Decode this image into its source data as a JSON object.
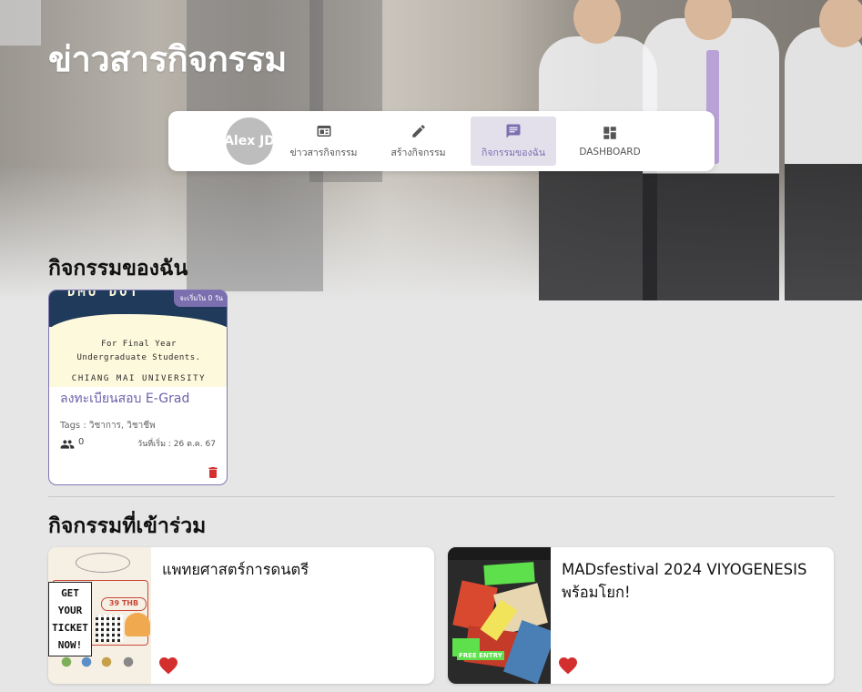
{
  "header": {
    "page_title": "ข่าวสารกิจกรรม"
  },
  "nav": {
    "avatar_text": "Alex JD",
    "items": [
      {
        "label": "ข่าวสารกิจกรรม",
        "icon": "newspaper-icon",
        "active": false
      },
      {
        "label": "สร้างกิจกรรม",
        "icon": "pencil-icon",
        "active": false
      },
      {
        "label": "กิจกรรมของฉัน",
        "icon": "chat-icon",
        "active": true
      },
      {
        "label": "DASHBOARD",
        "icon": "dashboard-icon",
        "active": false
      }
    ]
  },
  "my_activities": {
    "section_title": "กิจกรรมของฉัน",
    "cards": [
      {
        "title": "ลงทะเบียนสอบ E-Grad",
        "badge": "จะเริ่มใน 0 วัน",
        "poster_lines": [
          "For Final Year",
          "Undergraduate Students.",
          "CHIANG MAI UNIVERSITY"
        ],
        "tags": "Tags : วิชาการ, วิชาชีพ",
        "participants": "0",
        "start_date": "วันที่เริ่ม : 26 ต.ค. 67"
      }
    ]
  },
  "joined_activities": {
    "section_title": "กิจกรรมที่เข้าร่วม",
    "cards": [
      {
        "title": "แพทยศาสตร์การดนตรี",
        "poster_text": [
          "GET",
          "YOUR",
          "TICKET",
          "NOW!"
        ],
        "poster_price": "39 THB",
        "liked": true
      },
      {
        "title": "MADsfestival 2024 VIYOGENESIS พร้อมโยก!",
        "poster_text": [
          "FREE ENTRY"
        ],
        "liked": true
      }
    ]
  },
  "colors": {
    "accent": "#7b6fb0",
    "danger": "#d32f2f",
    "background": "#e6e6e6"
  }
}
